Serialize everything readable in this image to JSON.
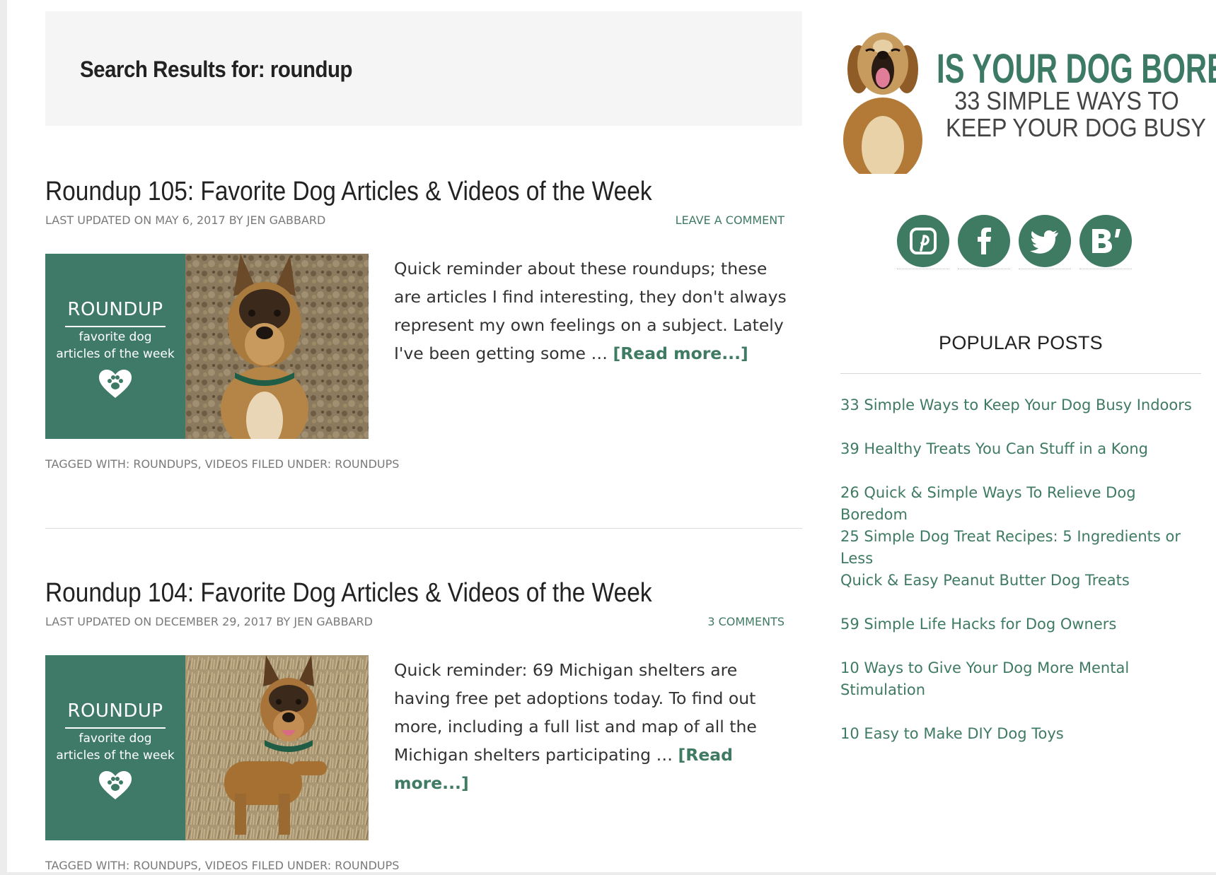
{
  "search": {
    "title": "Search Results for: roundup"
  },
  "posts": [
    {
      "title": "Roundup 105: Favorite Dog Articles & Videos of the Week",
      "meta": "Last updated on May 6, 2017 by Jen Gabbard",
      "comments": "Leave a Comment",
      "thumb_word": "ROUNDUP",
      "thumb_sub1": "favorite dog",
      "thumb_sub2": "articles of the week",
      "excerpt": "Quick reminder about these roundups; these are articles I find interesting, they don't always represent my own feelings on a subject. Lately I've been getting some … ",
      "read_more": "[Read more...]",
      "tags": "Tagged With: Roundups, Videos Filed Under: Roundups"
    },
    {
      "title": "Roundup 104: Favorite Dog Articles & Videos of the Week",
      "meta": "Last updated on December 29, 2017 by Jen Gabbard",
      "comments": "3 Comments",
      "thumb_word": "ROUNDUP",
      "thumb_sub1": "favorite dog",
      "thumb_sub2": "articles of the week",
      "excerpt": "Quick reminder: 69 Michigan shelters are having free pet adoptions today. To find out more, including a full list and map of all the Michigan shelters participating … ",
      "read_more": "[Read more...]",
      "tags": "Tagged With: Roundups, Videos Filed Under: Roundups"
    }
  ],
  "sidebar": {
    "banner": {
      "title": "IS YOUR DOG BORED?",
      "sub1": "33 SIMPLE WAYS TO",
      "sub2": "KEEP YOUR DOG BUSY"
    },
    "social": [
      {
        "name": "pinterest",
        "icon": "pinterest-icon"
      },
      {
        "name": "facebook",
        "icon": "facebook-icon"
      },
      {
        "name": "twitter",
        "icon": "twitter-icon"
      },
      {
        "name": "bloglovin",
        "icon": "bloglovin-icon"
      }
    ],
    "popular_heading": "Popular Posts",
    "popular_posts": [
      "33 Simple Ways to Keep Your Dog Busy Indoors",
      "39 Healthy Treats You Can Stuff in a Kong",
      "26 Quick & Simple Ways To Relieve Dog Boredom",
      "25 Simple Dog Treat Recipes: 5 Ingredients or Less",
      "Quick & Easy Peanut Butter Dog Treats",
      "59 Simple Life Hacks for Dog Owners",
      "10 Ways to Give Your Dog More Mental Stimulation",
      "10 Easy to Make DIY Dog Toys"
    ]
  },
  "colors": {
    "accent": "#3f7a63",
    "thumb_green": "#3f7a68",
    "search_bg": "#f5f5f5"
  }
}
